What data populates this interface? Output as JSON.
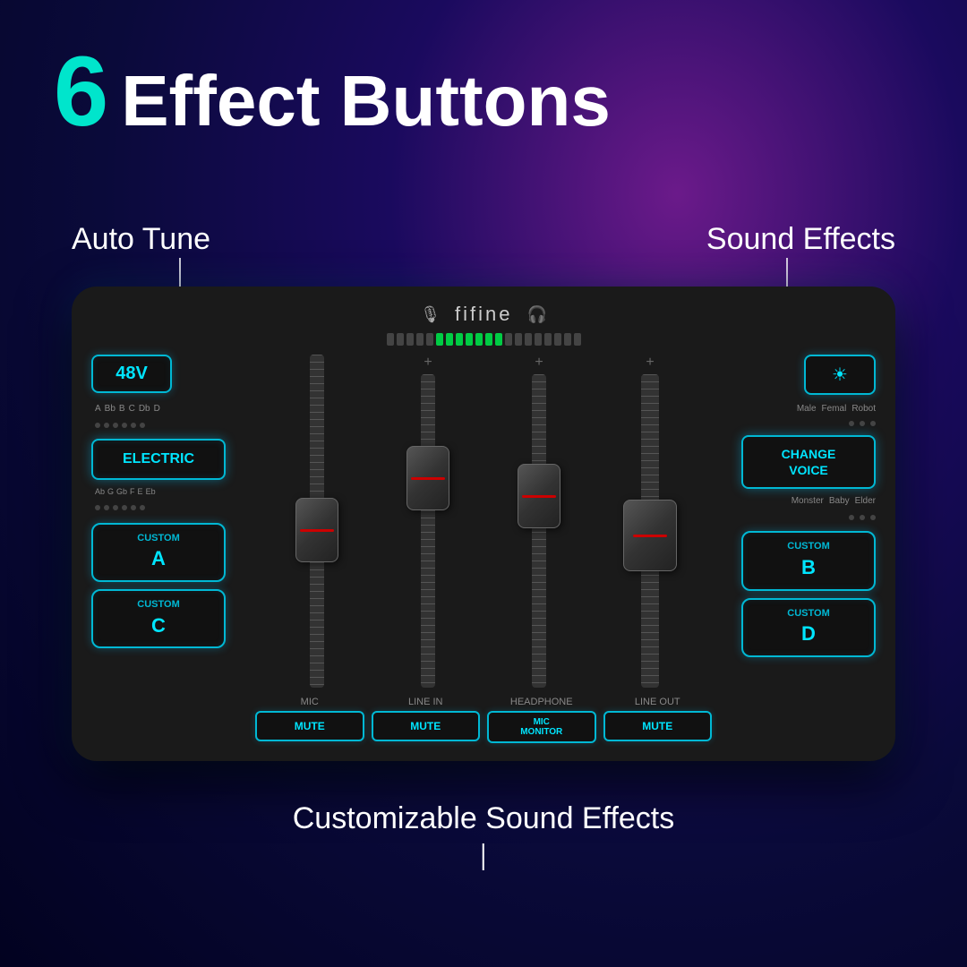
{
  "title": {
    "number": "6",
    "text": "Effect Buttons"
  },
  "labels": {
    "auto_tune": "Auto Tune",
    "sound_effects": "Sound Effects",
    "customizable": "Customizable Sound Effects"
  },
  "brand": "fifine",
  "controls": {
    "left_panel": {
      "btn_48v": "48V",
      "notes_top": [
        "A",
        "Bb",
        "B",
        "C",
        "Db",
        "D"
      ],
      "btn_electric": "ELECTRIC",
      "notes_bottom": [
        "Ab",
        "G",
        "Gb",
        "F",
        "E",
        "Eb"
      ],
      "btn_custom_a_label": "CUSTOM",
      "btn_custom_a_letter": "A",
      "btn_custom_c_label": "CUSTOM",
      "btn_custom_c_letter": "C"
    },
    "right_panel": {
      "btn_rgb_icon": "☀",
      "modes_top": [
        "Male",
        "Femal",
        "Robot"
      ],
      "btn_change_voice": "CHANGE\nVOICE",
      "modes_bottom": [
        "Monster",
        "Baby",
        "Elder"
      ],
      "btn_custom_b_label": "CUSTOM",
      "btn_custom_b_letter": "B",
      "btn_custom_d_label": "CUSTOM",
      "btn_custom_d_letter": "D"
    },
    "bottom": {
      "channels": [
        {
          "label": "MIC",
          "btn": "MUTE"
        },
        {
          "label": "LINE IN",
          "btn": "MUTE"
        },
        {
          "label": "HEADPHONE",
          "btn": "MIC\nMONITOR"
        },
        {
          "label": "LINE OUT",
          "btn": "MUTE"
        }
      ]
    }
  }
}
